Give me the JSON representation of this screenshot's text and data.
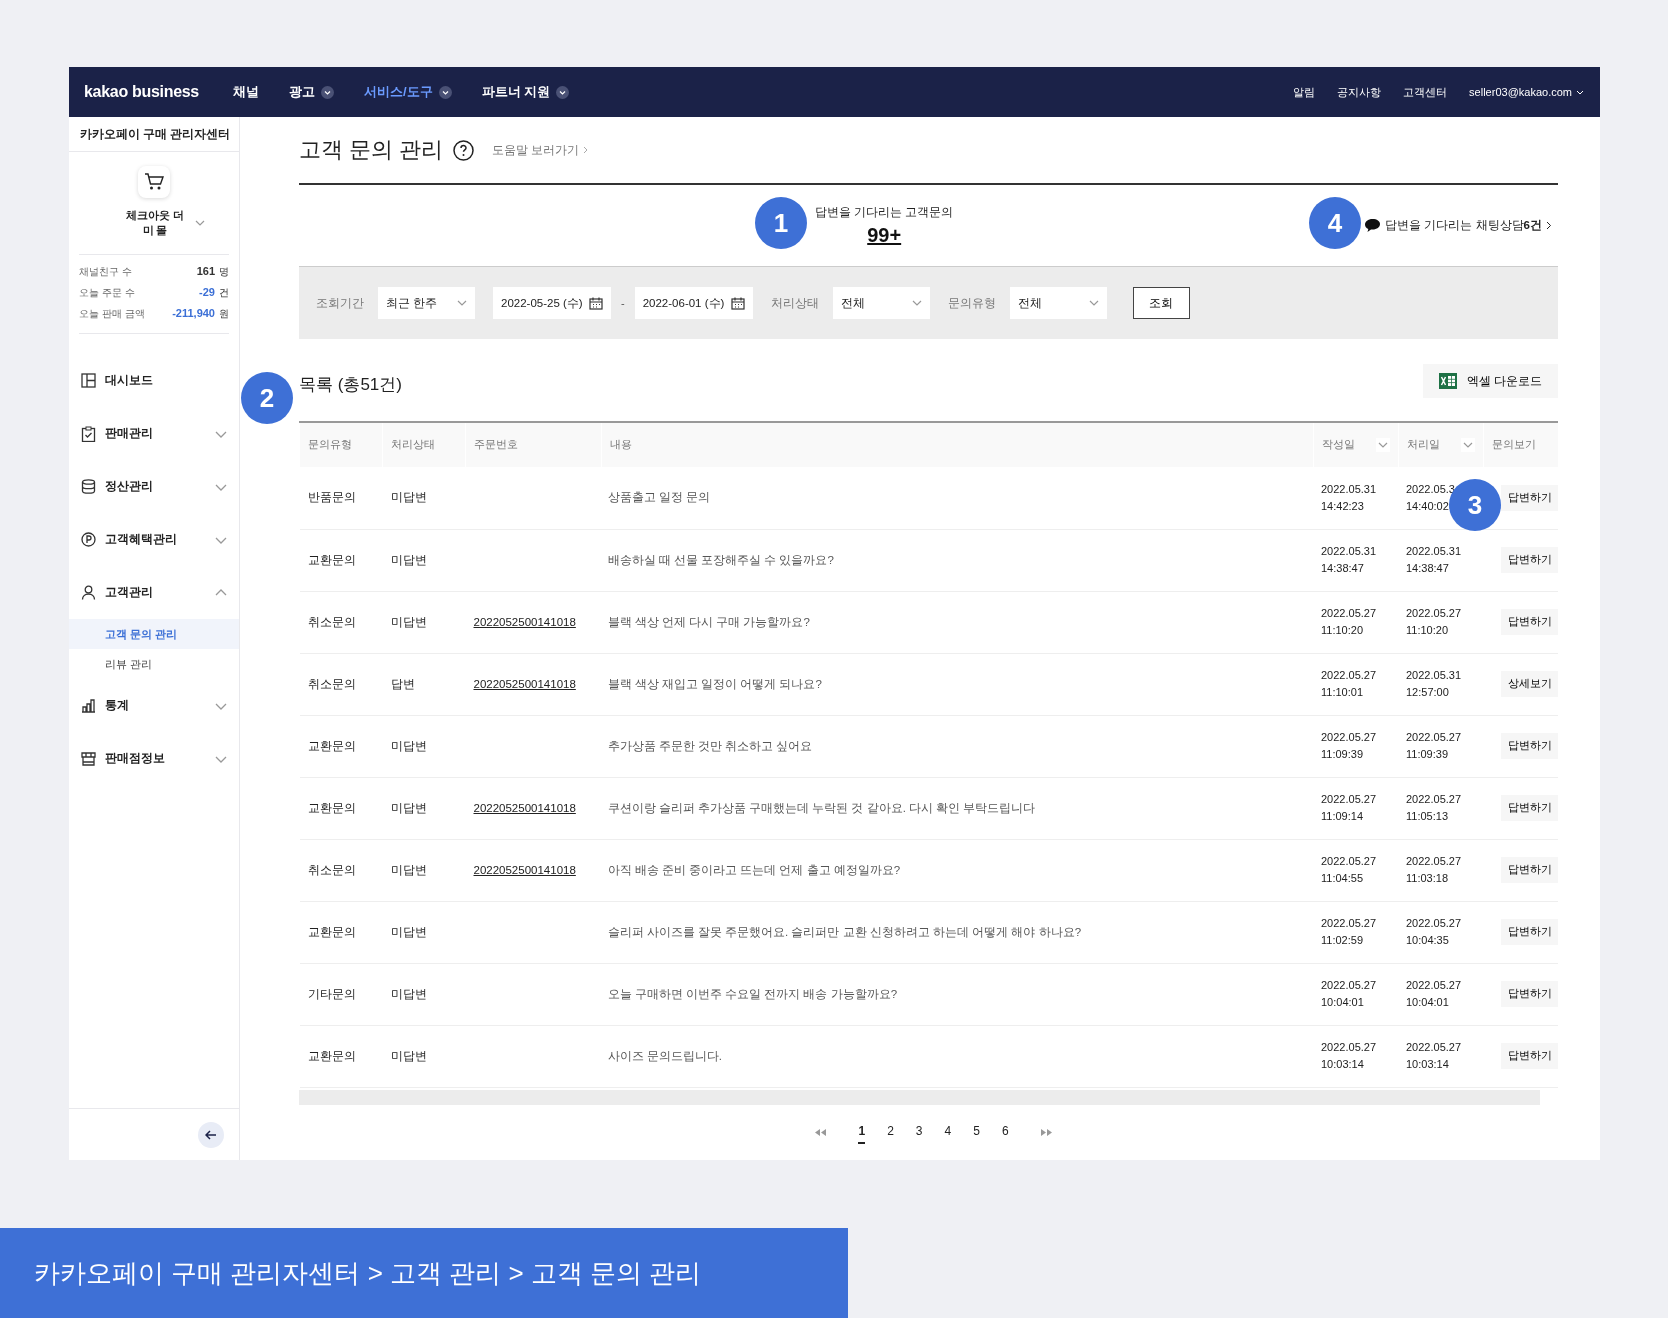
{
  "nav": {
    "logo": "kakao business",
    "items": [
      {
        "label": "채널",
        "selected": false,
        "dropdown": false
      },
      {
        "label": "광고",
        "selected": false,
        "dropdown": true
      },
      {
        "label": "서비스/도구",
        "selected": true,
        "dropdown": true
      },
      {
        "label": "파트너 지원",
        "selected": false,
        "dropdown": true
      }
    ],
    "links": [
      "알림",
      "공지사항",
      "고객센터"
    ],
    "account": "seller03@kakao.com"
  },
  "sidebar": {
    "title": "카카오페이 구매 관리자센터",
    "store": "체크아웃 더미 몰",
    "stats": [
      {
        "label": "채널친구 수",
        "value": "161",
        "unit": "명",
        "color": "#333333"
      },
      {
        "label": "오늘 주문 수",
        "value": "-29",
        "unit": "건",
        "color": "#3b6fd6"
      },
      {
        "label": "오늘 판매 금액",
        "value": "-211,940",
        "unit": "원",
        "color": "#3b6fd6"
      }
    ],
    "menu": [
      {
        "label": "대시보드",
        "expandable": false
      },
      {
        "label": "판매관리",
        "expandable": true,
        "expanded": false
      },
      {
        "label": "정산관리",
        "expandable": true,
        "expanded": false
      },
      {
        "label": "고객혜택관리",
        "expandable": true,
        "expanded": false
      },
      {
        "label": "고객관리",
        "expandable": true,
        "expanded": true,
        "children": [
          {
            "label": "고객 문의 관리",
            "selected": true
          },
          {
            "label": "리뷰 관리",
            "selected": false
          }
        ]
      },
      {
        "label": "통계",
        "expandable": true,
        "expanded": false
      },
      {
        "label": "판매점정보",
        "expandable": true,
        "expanded": false
      }
    ]
  },
  "page": {
    "title": "고객 문의 관리",
    "help_link": "도움말 보러가기"
  },
  "summary": {
    "label": "답변을 기다리는 고객문의",
    "count": "99+",
    "chat": "답변을 기다리는 채팅상담**6건**"
  },
  "filters": [
    {
      "kind": "select",
      "label": "조회기간",
      "value": "최근 한주"
    },
    {
      "kind": "date_range",
      "from": "2022-05-25 (수)",
      "separator": "-",
      "to": "2022-06-01 (수)"
    },
    {
      "kind": "select",
      "label": "처리상태",
      "value": "전체"
    },
    {
      "kind": "select",
      "label": "문의유형",
      "value": "전체"
    },
    {
      "kind": "button",
      "label": "조회"
    }
  ],
  "list": {
    "title": "목록 (총51건)",
    "download": "엑셀 다운로드"
  },
  "table": {
    "columns": [
      {
        "label": "문의유형",
        "sortable": false
      },
      {
        "label": "처리상태",
        "sortable": false
      },
      {
        "label": "주문번호",
        "sortable": false
      },
      {
        "label": "내용",
        "sortable": false
      },
      {
        "label": "작성일",
        "sortable": true
      },
      {
        "label": "처리일",
        "sortable": true
      },
      {
        "label": "문의보기",
        "sortable": false
      }
    ],
    "rows": [
      {
        "type": "반품문의",
        "status": "미답변",
        "content": "상품출고 일정 문의",
        "created_date": "2022.05.31",
        "created_time": "14:42:23",
        "processed_date": "2022.05.3",
        "processed_time": "14:40:02",
        "action": "답변하기"
      },
      {
        "type": "교환문의",
        "status": "미답변",
        "content": "배송하실 때 선물 포장해주실 수 있을까요?",
        "created_date": "2022.05.31",
        "created_time": "14:38:47",
        "processed_date": "2022.05.31",
        "processed_time": "14:38:47",
        "action": "답변하기"
      },
      {
        "type": "취소문의",
        "status": "미답변",
        "order": "2022052500141018",
        "content": "블랙 색상 언제 다시 구매 가능할까요?",
        "created_date": "2022.05.27",
        "created_time": "11:10:20",
        "processed_date": "2022.05.27",
        "processed_time": "11:10:20",
        "action": "답변하기"
      },
      {
        "type": "취소문의",
        "status": "답변",
        "order": "2022052500141018",
        "content": "블랙 색상 재입고 일정이 어떻게 되나요?",
        "created_date": "2022.05.27",
        "created_time": "11:10:01",
        "processed_date": "2022.05.31",
        "processed_time": "12:57:00",
        "action": "상세보기"
      },
      {
        "type": "교환문의",
        "status": "미답변",
        "content": "추가상품 주문한 것만 취소하고 싶어요",
        "created_date": "2022.05.27",
        "created_time": "11:09:39",
        "processed_date": "2022.05.27",
        "processed_time": "11:09:39",
        "action": "답변하기"
      },
      {
        "type": "교환문의",
        "status": "미답변",
        "order": "2022052500141018",
        "content": "쿠션이랑 슬리퍼 추가상품 구매했는데 누락된 것 같아요. 다시 확인 부탁드립니다",
        "created_date": "2022.05.27",
        "created_time": "11:09:14",
        "processed_date": "2022.05.27",
        "processed_time": "11:05:13",
        "action": "답변하기"
      },
      {
        "type": "취소문의",
        "status": "미답변",
        "order": "2022052500141018",
        "content": "아직 배송 준비 중이라고 뜨는데 언제 출고 예정일까요?",
        "created_date": "2022.05.27",
        "created_time": "11:04:55",
        "processed_date": "2022.05.27",
        "processed_time": "11:03:18",
        "action": "답변하기"
      },
      {
        "type": "교환문의",
        "status": "미답변",
        "content": "슬리퍼 사이즈를 잘못 주문했어요. 슬리퍼만 교환 신청하려고 하는데 어떻게 해야 하나요?",
        "created_date": "2022.05.27",
        "created_time": "11:02:59",
        "processed_date": "2022.05.27",
        "processed_time": "10:04:35",
        "action": "답변하기"
      },
      {
        "type": "기타문의",
        "status": "미답변",
        "content": "오늘 구매하면 이번주 수요일 전까지 배송 가능할까요?",
        "created_date": "2022.05.27",
        "created_time": "10:04:01",
        "processed_date": "2022.05.27",
        "processed_time": "10:04:01",
        "action": "답변하기"
      },
      {
        "type": "교환문의",
        "status": "미답변",
        "content": "사이즈 문의드립니다.",
        "created_date": "2022.05.27",
        "created_time": "10:03:14",
        "processed_date": "2022.05.27",
        "processed_time": "10:03:14",
        "action": "답변하기"
      }
    ]
  },
  "pagination": [
    {
      "label": "1",
      "selected": true
    },
    {
      "label": "2",
      "selected": false
    },
    {
      "label": "3",
      "selected": false
    },
    {
      "label": "4",
      "selected": false
    },
    {
      "label": "5",
      "selected": false
    },
    {
      "label": "6",
      "selected": false
    }
  ],
  "callouts": [
    "1",
    "2",
    "3",
    "4"
  ],
  "caption": "카카오페이 구매 관리자센터 > 고객 관리 > 고객 문의 관리"
}
